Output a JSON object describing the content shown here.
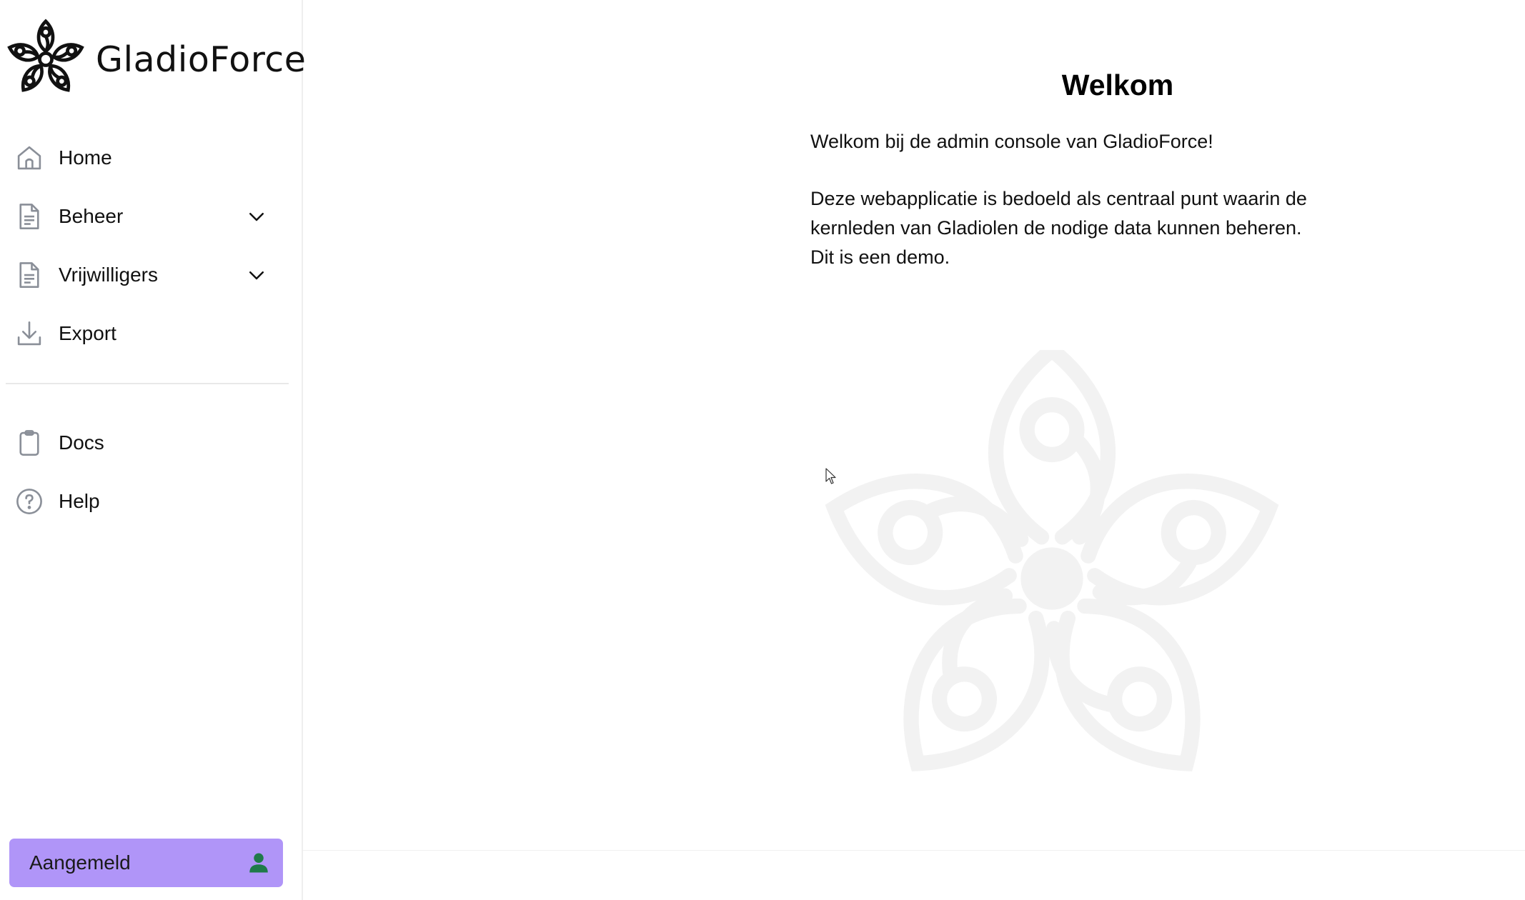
{
  "brand": {
    "name": "GladioForce",
    "logo_icon": "gladiolus-flower-logo"
  },
  "sidebar": {
    "items": [
      {
        "label": "Home",
        "icon": "home-icon",
        "expandable": false
      },
      {
        "label": "Beheer",
        "icon": "document-icon",
        "expandable": true
      },
      {
        "label": "Vrijwilligers",
        "icon": "document-icon",
        "expandable": true
      },
      {
        "label": "Export",
        "icon": "download-icon",
        "expandable": false
      }
    ],
    "secondary_items": [
      {
        "label": "Docs",
        "icon": "clipboard-icon"
      },
      {
        "label": "Help",
        "icon": "help-circle-icon"
      }
    ],
    "user": {
      "label": "Aangemeld",
      "icon": "user-icon",
      "background": "#b095f8",
      "icon_color": "#1f7a4a"
    }
  },
  "main": {
    "title": "Welkom",
    "intro": "Welkom bij de admin console van GladioForce!",
    "body": "Deze webapplicatie is bedoeld als centraal punt waarin de kernleden van Gladiolen de nodige data kunnen beheren. Dit is een demo.",
    "watermark_icon": "gladiolus-flower-watermark"
  },
  "colors": {
    "accent": "#b095f8",
    "icon_gray": "#8a8f98",
    "watermark": "#f2f2f2"
  }
}
